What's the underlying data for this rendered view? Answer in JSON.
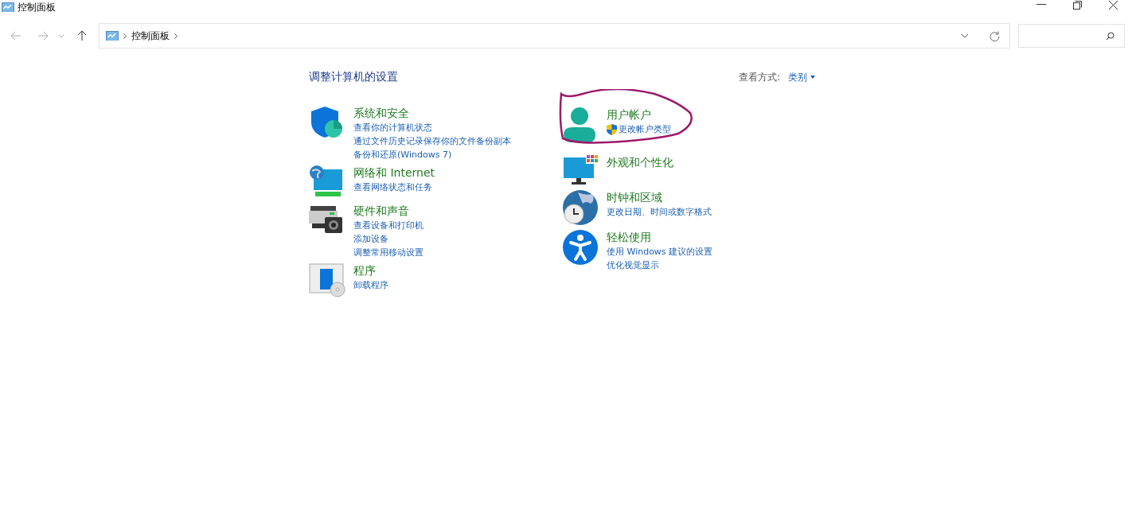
{
  "window": {
    "title": "控制面板"
  },
  "address_bar": {
    "crumbs": [
      "控制面板"
    ]
  },
  "page": {
    "heading": "调整计算机的设置",
    "view_label": "查看方式:",
    "view_value": "类别"
  },
  "columns": [
    [
      {
        "kind": "security",
        "title": "系统和安全",
        "links": [
          {
            "text": "查看你的计算机状态",
            "uac": false
          },
          {
            "text": "通过文件历史记录保存你的文件备份副本",
            "uac": false
          },
          {
            "text": "备份和还原(Windows 7)",
            "uac": false
          }
        ]
      },
      {
        "kind": "network",
        "title": "网络和 Internet",
        "links": [
          {
            "text": "查看网络状态和任务",
            "uac": false
          }
        ]
      },
      {
        "kind": "hardware",
        "title": "硬件和声音",
        "links": [
          {
            "text": "查看设备和打印机",
            "uac": false
          },
          {
            "text": "添加设备",
            "uac": false
          },
          {
            "text": "调整常用移动设置",
            "uac": false
          }
        ]
      },
      {
        "kind": "programs",
        "title": "程序",
        "links": [
          {
            "text": "卸载程序",
            "uac": false
          }
        ]
      }
    ],
    [
      {
        "kind": "user",
        "title": "用户帐户",
        "circled": true,
        "links": [
          {
            "text": "更改帐户类型",
            "uac": true
          }
        ]
      },
      {
        "kind": "appearance",
        "title": "外观和个性化",
        "circled": false
      },
      {
        "kind": "clock",
        "title": "时钟和区域",
        "circled": false,
        "links": [
          {
            "text": "更改日期、时间或数字格式",
            "uac": false
          }
        ]
      },
      {
        "kind": "ease",
        "title": "轻松使用",
        "circled": false,
        "links": [
          {
            "text": "使用 Windows 建议的设置",
            "uac": false
          },
          {
            "text": "优化视觉显示",
            "uac": false
          }
        ]
      }
    ]
  ]
}
